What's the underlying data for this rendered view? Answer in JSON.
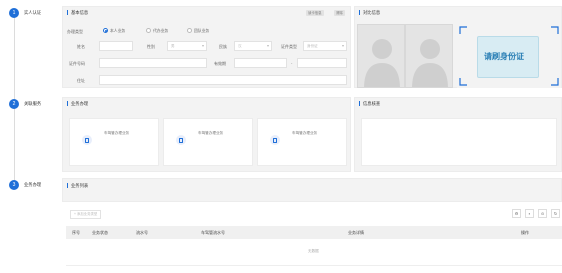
{
  "steps": [
    {
      "num": "1",
      "label": "实人认证"
    },
    {
      "num": "2",
      "label": "关联服务"
    },
    {
      "num": "3",
      "label": "业务办理"
    }
  ],
  "basic_info": {
    "title": "基本信息",
    "tag_read_card": "读卡信息",
    "tag_clear": "清除",
    "handle_type_label": "办理类型",
    "radio_options": [
      "本人业务",
      "代办业务",
      "团队业务"
    ],
    "name_label": "姓名",
    "gender_label": "性别",
    "gender_placeholder": "男",
    "ethnicity_label": "民族",
    "ethnicity_placeholder": "汉",
    "id_type_label": "证件类型",
    "id_type_placeholder": "身份证",
    "id_number_label": "证件号码",
    "validity_label": "有效期",
    "validity_separator": "-",
    "address_label": "住址"
  },
  "compare_info": {
    "title": "对比信息",
    "scan_hint": "请刷身份证"
  },
  "business_handle": {
    "title": "业务办理",
    "cards": [
      "车驾管办理业务",
      "车驾管办理业务",
      "车驾管办理业务"
    ]
  },
  "info_confirm": {
    "title": "信息核查"
  },
  "business_list": {
    "title": "业务列表",
    "add_button": "+ 添加业务类型",
    "columns": [
      "序号",
      "业务状态",
      "流水号",
      "车驾管流水号",
      "业务详情",
      "操作"
    ],
    "empty_text": "无数据"
  },
  "icons": [
    "step-1",
    "step-2",
    "step-3",
    "settings-icon",
    "print-icon",
    "export-icon",
    "refresh-icon",
    "person-silhouette-icon",
    "id-card-icon",
    "document-icon"
  ],
  "colors": {
    "accent": "#1f6fd8",
    "panel_bg": "#f3f3f3"
  }
}
